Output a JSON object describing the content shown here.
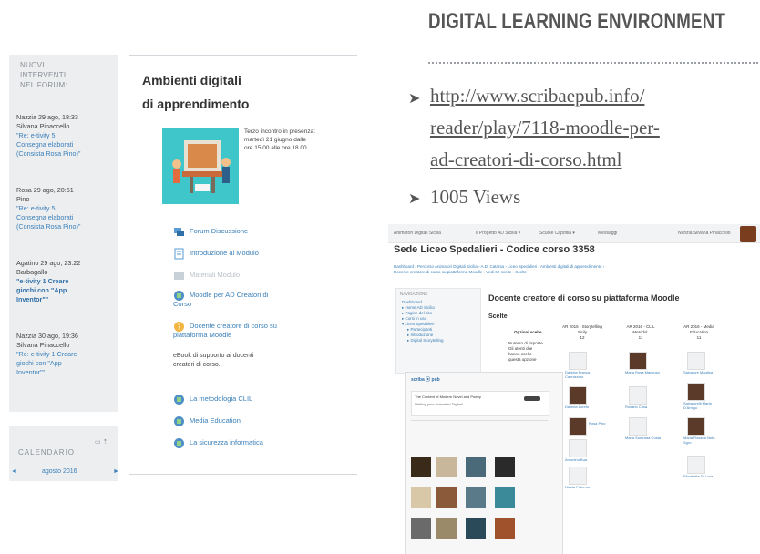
{
  "sidebar": {
    "heading": [
      "NUOVI",
      "INTERVENTI",
      "NEL FORUM:"
    ],
    "posts": [
      {
        "meta": "Nazzia  29 ago, 18:33",
        "author": "Silvana Pinaccello",
        "lines": [
          "\"Re: e-tivity 5",
          "Consegna elaborati",
          "(Consista Rosa Pino)\""
        ],
        "bold": false
      },
      {
        "meta": "Rosa   29 ago, 20:51",
        "author": "Pino",
        "lines": [
          "\"Re: e-tivity 5",
          "Consegna elaborati",
          "(Consista Rosa Pino)\""
        ],
        "bold": false
      },
      {
        "meta": "Agatino 29 ago, 23:22",
        "author": "Barbagallo",
        "lines": [
          "\"e-tivity 1 Creare",
          "giochi con \"App",
          "Inventor\"\""
        ],
        "bold": true
      },
      {
        "meta": "Nazzia  30 ago, 19:36",
        "author": "Silvana Pinaccello",
        "lines": [
          "\"Re: e-tivity 1 Creare",
          "giochi con \"App",
          "Inventor\"\""
        ],
        "bold": false
      }
    ]
  },
  "calendar": {
    "title": "CALENDARIO",
    "month": "agosto 2016",
    "prev": "◄",
    "next": "►",
    "icons": "▭ ⇡"
  },
  "main": {
    "title_line1": "Ambienti digitali",
    "title_line2": "di apprendimento",
    "meeting": [
      "Terzo incontro in presenza:",
      "martedì 21 giugno dalle",
      "ore 15.00 alle ore 18.00"
    ],
    "resources": [
      {
        "label": "Forum Discussione",
        "icon": "forum-icon"
      },
      {
        "label": "Introduzione al Modulo",
        "icon": "page-icon"
      },
      {
        "label": "Materiali Modulo",
        "icon": "folder-icon"
      },
      {
        "label": "Moodle per AD Creatori di",
        "label2": "Corso",
        "icon": "book-icon"
      },
      {
        "label": "Docente creatore di corso su",
        "label2": "piattaforma Moodle",
        "icon": "question-icon"
      }
    ],
    "note": [
      "eBook di supporto ai docenti",
      "creatori di corso."
    ],
    "resources2": [
      {
        "label": "La metodologia CLIL",
        "icon": "book-icon"
      },
      {
        "label": "Media Education",
        "icon": "book-icon"
      },
      {
        "label": "La sicurezza informatica",
        "icon": "book-icon"
      }
    ]
  },
  "right": {
    "heading": "DIGITAL LEARNING ENVIRONMENT",
    "bullet": "➤",
    "url_lines": [
      "http://www.scribaepub.info/",
      "reader/play/7118-moodle-per-",
      "ad-creatori-di-corso.html"
    ],
    "views": "1005 Views"
  },
  "embedded": {
    "topbar": [
      "Animatori Digitali Sicilia",
      "Il Progetto AD Sicilia ▾",
      "Scuole Capofila ▾",
      "Messaggi",
      "Nunzia Silvana Pinaccello"
    ],
    "title": "Sede Liceo Spedalieri - Codice corso 3358",
    "breadcrumb": [
      "Dashboard  ›  Percorso Animatori Digitali Sicilia  ›  A.D. Catania  ›  Liceo Spedalieri  ›  Ambienti digitali di apprendimento  ›",
      "Docente creatore di corso su piattaforma Moodle  ›  Vedi 62 scelte  ›  Scelte"
    ],
    "nav_title": "NAVIGAZIONE",
    "nav_items": [
      "Dashboard",
      "▸ Home AD Sicilia",
      "▸ Pagine del sito",
      "▸ Corsi in uso",
      "▾ Liceo Spedalieri",
      "▸ Partecipanti",
      "▸ Introduzione",
      "▸ Digital Storytelling"
    ],
    "heading": "Docente creatore di corso su piattaforma Moodle",
    "scelte": "Scelte",
    "options_label": "Opzioni scelte",
    "options_desc": [
      "Numero di risposte",
      "Gli utenti che",
      "hanno scelto",
      "questa opzione"
    ],
    "columns": [
      {
        "title": [
          "AR 2016 - Storytelling",
          "Sicily"
        ],
        "count": "12"
      },
      {
        "title": [
          "AR 2016 - CLIL",
          "Metodol."
        ],
        "count": "11"
      },
      {
        "title": [
          "AR 2016 - Media",
          "Education"
        ],
        "count": "11"
      }
    ],
    "names_col1": [
      "Daniela Franca Cannizzaro",
      "Daniela Loreto",
      "Rosa Pino",
      "Antonino Bua",
      "Nicola Palermo"
    ],
    "names_col2": [
      "Maria Rosa Mancuso",
      "Rosario Cosa",
      "Maria Sumrada Costa"
    ],
    "names_col3": [
      "Salvatore Mautica",
      "Salvatorelli Maria D'Amigo",
      "Maria Rosaria Nota Sgro",
      "Elisabetta Di Luca"
    ],
    "inner_title": "The Content of Modern Novel and Poetry",
    "inner_sub": "Visiting your Animatori Digitali",
    "inner_logo": "scriba ⦿ pub"
  }
}
